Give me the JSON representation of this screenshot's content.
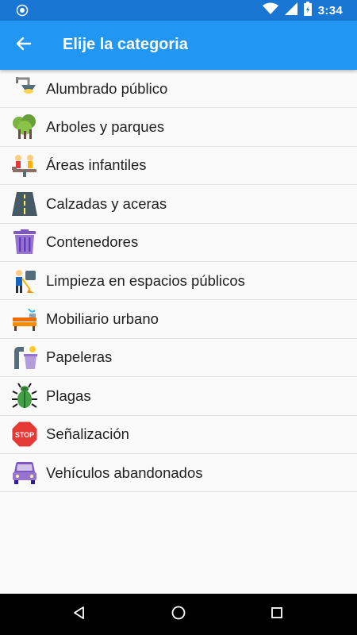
{
  "status_bar": {
    "time": "3:34"
  },
  "app_bar": {
    "title": "Elije la categoria"
  },
  "categories": [
    {
      "label": "Alumbrado público",
      "icon": "street-lamp-icon"
    },
    {
      "label": "Arboles y parques",
      "icon": "trees-icon"
    },
    {
      "label": "Áreas infantiles",
      "icon": "playground-icon"
    },
    {
      "label": "Calzadas y aceras",
      "icon": "road-icon"
    },
    {
      "label": "Contenedores",
      "icon": "trash-container-icon"
    },
    {
      "label": "Limpieza en espacios públicos",
      "icon": "street-cleaner-icon"
    },
    {
      "label": "Mobiliario urbano",
      "icon": "bench-fountain-icon"
    },
    {
      "label": "Papeleras",
      "icon": "litter-bin-icon"
    },
    {
      "label": "Plagas",
      "icon": "beetle-icon"
    },
    {
      "label": "Señalización",
      "icon": "stop-sign-icon"
    },
    {
      "label": "Vehículos abandonados",
      "icon": "car-icon"
    }
  ],
  "colors": {
    "app_bar": "#2196f3",
    "status_bar": "#1976d2"
  }
}
